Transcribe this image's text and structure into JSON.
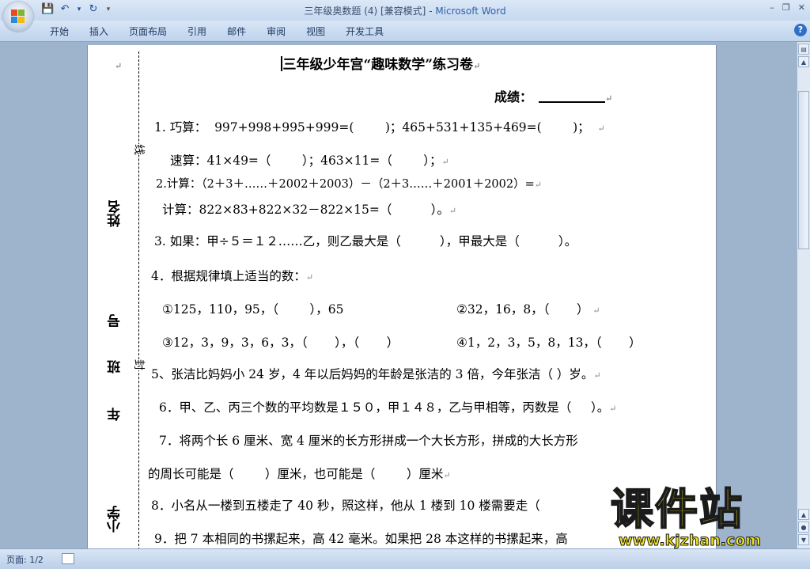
{
  "window": {
    "title": "三年级奥数题 (4) [兼容模式]",
    "title_sep": " - ",
    "app_name": "Microsoft Word",
    "controls": [
      "–",
      "❐",
      "✕"
    ]
  },
  "quick_access": {
    "save_icon": "💾",
    "undo_icon": "↶",
    "redo_icon": "↻",
    "more_icon": "▾"
  },
  "ribbon": {
    "tabs": [
      "开始",
      "插入",
      "页面布局",
      "引用",
      "邮件",
      "审阅",
      "视图",
      "开发工具"
    ],
    "help": "?"
  },
  "document": {
    "title": "三年级少年宫“趣味数学”练习卷",
    "score_label": "成绩：",
    "para_mark": "↵",
    "margin_labels": {
      "name": "姓名",
      "number": "号",
      "class": "班",
      "grade": "年",
      "school": "小学",
      "line_seal": "线",
      "seal": "封"
    },
    "lines": [
      "1. 巧算：  997+998+995+999=(        )；465+531+135+469=(        )；",
      "速算：41×49=（        ）；463×11=（        ）；",
      "2.计算：（2＋3＋……＋2002＋2003）－（2＋3……＋2001＋2002）=",
      "计算：822×83+822×32－822×15=（          ）。",
      "3. 如果：甲÷５＝１２……乙，则乙最大是（          ），甲最大是（          ）。",
      "4．根据规律填上适当的数：",
      "①125，110，95，（        ），65",
      "②32，16，8，（       ）",
      "③12，3，9，3，6，3，（       ），（       ）",
      "④1，2，3，5，8，13，（       ）",
      "5、张洁比妈妈小 24 岁，4 年以后妈妈的年龄是张洁的 3 倍，今年张洁（ ）岁。",
      "6．甲、乙、丙三个数的平均数是１５０，甲１４８，乙与甲相等，丙数是（     ）。",
      "7．将两个长 6 厘米、宽 4 厘米的长方形拼成一个大长方形，拼成的大长方形",
      "的周长可能是（        ）厘米，也可能是（        ）厘米",
      "8．小名从一楼到五楼走了 40 秒，照这样，他从 1 楼到 10 楼需要走（",
      "9．把 7 本相同的书摞起来，高 42 毫米。如果把 28 本这样的书摞起来，高"
    ]
  },
  "status": {
    "page_info": "页面: 1/2"
  },
  "watermark": {
    "text": "课件站",
    "url": "www.kjzhan.com"
  }
}
